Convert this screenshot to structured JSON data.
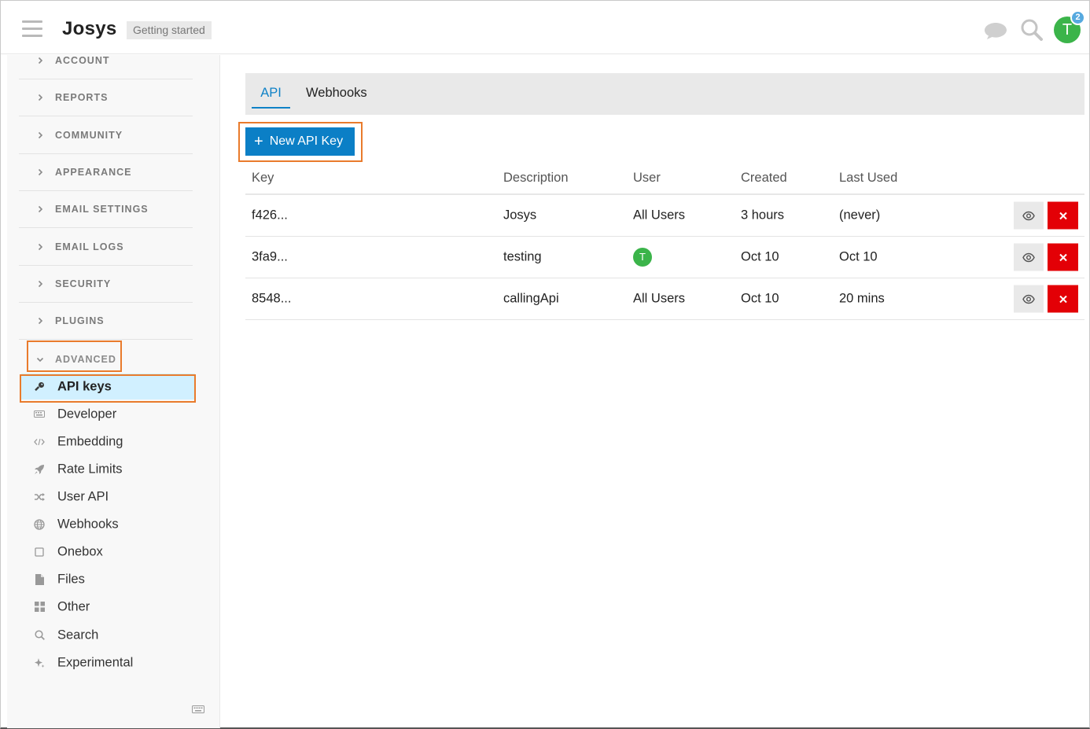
{
  "header": {
    "logo": "Josys",
    "getting_started": "Getting started",
    "notification_count": "2",
    "avatar_letter": "T"
  },
  "sidebar": {
    "sections": [
      {
        "label": "ACCOUNT"
      },
      {
        "label": "REPORTS"
      },
      {
        "label": "COMMUNITY"
      },
      {
        "label": "APPEARANCE"
      },
      {
        "label": "EMAIL SETTINGS"
      },
      {
        "label": "EMAIL LOGS"
      },
      {
        "label": "SECURITY"
      },
      {
        "label": "PLUGINS"
      },
      {
        "label": "ADVANCED"
      }
    ],
    "advanced_items": [
      {
        "label": "API keys",
        "icon": "key-icon",
        "active": true
      },
      {
        "label": "Developer",
        "icon": "keyboard-icon"
      },
      {
        "label": "Embedding",
        "icon": "code-icon"
      },
      {
        "label": "Rate Limits",
        "icon": "rocket-icon"
      },
      {
        "label": "User API",
        "icon": "random-icon"
      },
      {
        "label": "Webhooks",
        "icon": "globe-icon"
      },
      {
        "label": "Onebox",
        "icon": "square-icon"
      },
      {
        "label": "Files",
        "icon": "file-icon"
      },
      {
        "label": "Other",
        "icon": "grid-icon"
      },
      {
        "label": "Search",
        "icon": "search-icon"
      },
      {
        "label": "Experimental",
        "icon": "sparkle-icon"
      }
    ]
  },
  "main": {
    "tabs": [
      {
        "label": "API",
        "active": true
      },
      {
        "label": "Webhooks"
      }
    ],
    "new_button": "New API Key",
    "columns": [
      "Key",
      "Description",
      "User",
      "Created",
      "Last Used"
    ],
    "rows": [
      {
        "key": "f426...",
        "description": "Josys",
        "user": "All Users",
        "user_avatar": "",
        "created": "3 hours",
        "last_used": "(never)"
      },
      {
        "key": "3fa9...",
        "description": "testing",
        "user": "",
        "user_avatar": "T",
        "created": "Oct 10",
        "last_used": "Oct 10"
      },
      {
        "key": "8548...",
        "description": "callingApi",
        "user": "All Users",
        "user_avatar": "",
        "created": "Oct 10",
        "last_used": "20 mins"
      }
    ]
  },
  "colors": {
    "accent": "#0b7fc6",
    "danger": "#e30006",
    "highlight": "#e97b2c",
    "active_bg": "#d1f0ff",
    "avatar_green": "#3bb44a",
    "badge_blue": "#56a9df"
  }
}
